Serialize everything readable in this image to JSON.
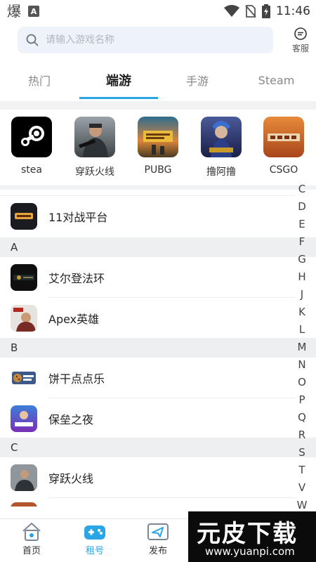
{
  "status_bar": {
    "time": "11:46",
    "left_glyph": "爆",
    "left_badge": "A"
  },
  "search": {
    "placeholder": "请输入游戏名称"
  },
  "service": {
    "label": "客服"
  },
  "tabs": [
    {
      "label": "热门"
    },
    {
      "label": "端游"
    },
    {
      "label": "手游"
    },
    {
      "label": "Steam"
    }
  ],
  "active_tab": "端游",
  "hot_games": [
    {
      "label": "stea",
      "icon": "steam-logo"
    },
    {
      "label": "穿跃火线",
      "icon": "soldier-portrait"
    },
    {
      "label": "PUBG",
      "icon": "pubg-cover"
    },
    {
      "label": "撸阿撸",
      "icon": "lol-cover"
    },
    {
      "label": "CSGO",
      "icon": "csgo-logo"
    }
  ],
  "games": [
    {
      "section": "",
      "name": "11对战平台"
    },
    {
      "section": "A",
      "name": "艾尔登法环"
    },
    {
      "section": "A",
      "name": "Apex英雄"
    },
    {
      "section": "B",
      "name": "饼干点点乐"
    },
    {
      "section": "B",
      "name": "保垒之夜"
    },
    {
      "section": "C",
      "name": "穿跃火线"
    }
  ],
  "sections": [
    "A",
    "B",
    "C"
  ],
  "index_letters": [
    "C",
    "D",
    "E",
    "F",
    "G",
    "H",
    "J",
    "K",
    "L",
    "M",
    "N",
    "O",
    "P",
    "Q",
    "R",
    "S",
    "T",
    "V",
    "W"
  ],
  "bottom_nav": [
    {
      "label": "首页",
      "icon": "home-icon"
    },
    {
      "label": "租号",
      "icon": "gamepad-icon"
    },
    {
      "label": "发布",
      "icon": "send-icon"
    }
  ],
  "active_nav": "租号",
  "watermark": {
    "title": "元皮下载",
    "url": "www.yuanpi.com"
  },
  "colors": {
    "accent": "#2aa6e6",
    "section_bg": "#eeeff1",
    "search_bg": "#eef3fa"
  }
}
